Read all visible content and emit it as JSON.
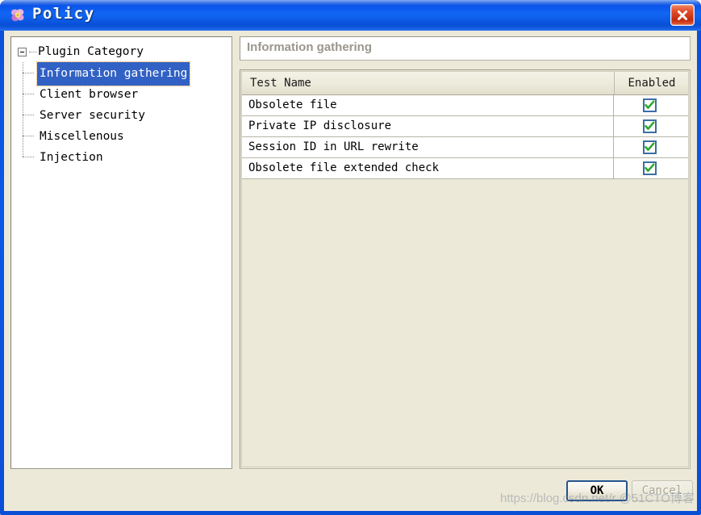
{
  "window": {
    "title": "Policy",
    "icon": "flower-app-icon",
    "close_label": "✕"
  },
  "tree": {
    "root": {
      "label": "Plugin Category",
      "expanded": true,
      "expander_icon": "minus-box-icon"
    },
    "items": [
      {
        "label": "Information gathering",
        "selected": true
      },
      {
        "label": "Client browser",
        "selected": false
      },
      {
        "label": "Server security",
        "selected": false
      },
      {
        "label": "Miscellenous",
        "selected": false
      },
      {
        "label": "Injection",
        "selected": false
      }
    ]
  },
  "detail": {
    "category_title": "Information gathering",
    "columns": {
      "name": "Test Name",
      "enabled": "Enabled"
    },
    "rows": [
      {
        "name": "Obsolete file",
        "enabled": true
      },
      {
        "name": "Private IP disclosure",
        "enabled": true
      },
      {
        "name": "Session ID in URL rewrite",
        "enabled": true
      },
      {
        "name": "Obsolete file extended check",
        "enabled": true
      }
    ]
  },
  "footer": {
    "ok_label": "OK",
    "cancel_label": "Cancel"
  },
  "watermark": {
    "text": "https://blog.csdn.net/r  @51CTO博客"
  },
  "colors": {
    "titlebar_blue": "#0d57e8",
    "selection_blue": "#3161c4",
    "focus_outline": "#e8a33d",
    "dialog_beige": "#ece9d8",
    "close_red": "#c32a0d",
    "check_green": "#2ea82e",
    "checkbox_border": "#3a6ea5",
    "header_text_gray": "#9a968c"
  }
}
